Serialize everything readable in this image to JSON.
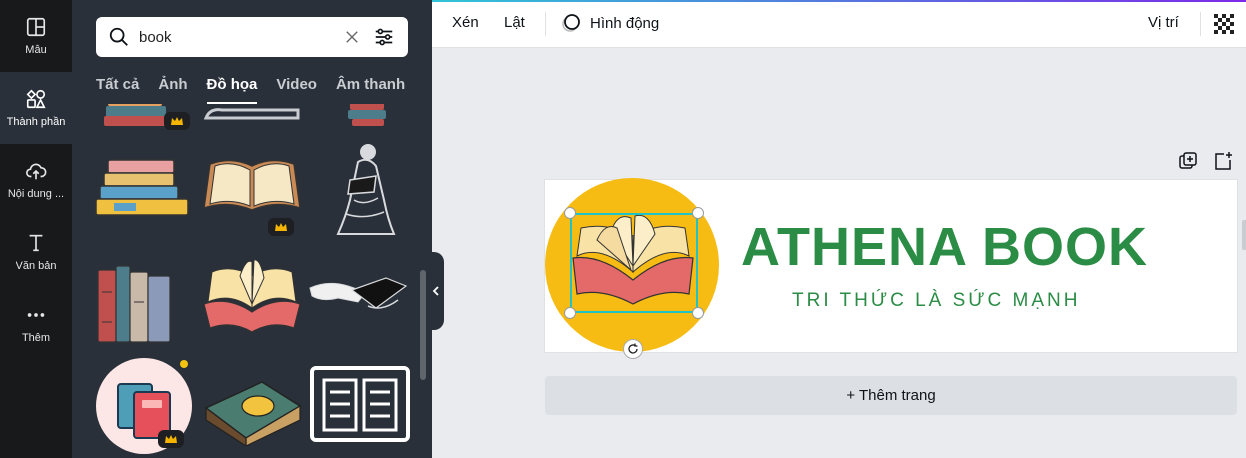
{
  "rail": {
    "items": [
      {
        "label": "Mẫu"
      },
      {
        "label": "Thành phần"
      },
      {
        "label": "Nội dung ..."
      },
      {
        "label": "Văn bản"
      },
      {
        "label": "Thêm"
      }
    ]
  },
  "search": {
    "value": "book",
    "placeholder": "Tìm kiếm"
  },
  "tabs": [
    {
      "label": "Tất cả"
    },
    {
      "label": "Ảnh"
    },
    {
      "label": "Đồ họa"
    },
    {
      "label": "Video"
    },
    {
      "label": "Âm thanh"
    }
  ],
  "active_tab": "Đồ họa",
  "toolbar": {
    "crop": "Xén",
    "flip": "Lật",
    "animate": "Hình động",
    "position": "Vị trí"
  },
  "design": {
    "brand_name": "ATHENA BOOK",
    "slogan": "TRI THỨC LÀ SỨC MẠNH",
    "brand_color": "#2a8c45",
    "circle_color": "#f7bc14"
  },
  "add_page": "+ Thêm trang",
  "colors": {
    "rail_bg": "#18191b",
    "panel_bg": "#293039",
    "selection": "#1fc3c8"
  }
}
